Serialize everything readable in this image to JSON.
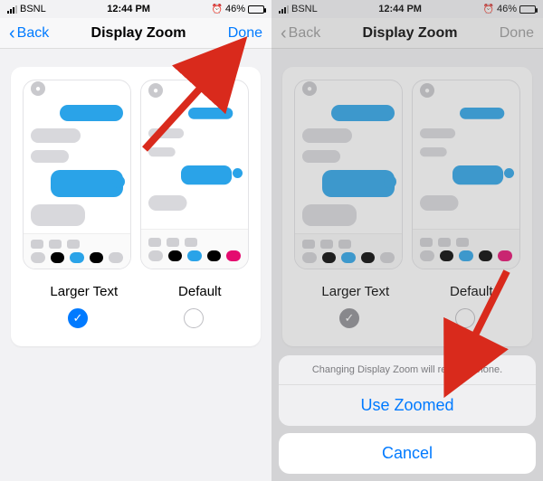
{
  "status": {
    "carrier": "BSNL",
    "time": "12:44 PM",
    "battery_text": "46%",
    "alarm_glyph": "⏰"
  },
  "nav": {
    "back_label": "Back",
    "title": "Display Zoom",
    "done_label": "Done"
  },
  "options": {
    "larger_label": "Larger Text",
    "default_label": "Default"
  },
  "sheet": {
    "message": "Changing Display Zoom will restart iPhone.",
    "use_label": "Use Zoomed",
    "cancel_label": "Cancel"
  },
  "preview_dots": {
    "colors_large": [
      "#d0d0d4",
      "#000",
      "#2aa3e8",
      "#000",
      "#d0d0d4"
    ],
    "colors_default": [
      "#d0d0d4",
      "#000",
      "#2aa3e8",
      "#000",
      "#e40b6f"
    ]
  }
}
